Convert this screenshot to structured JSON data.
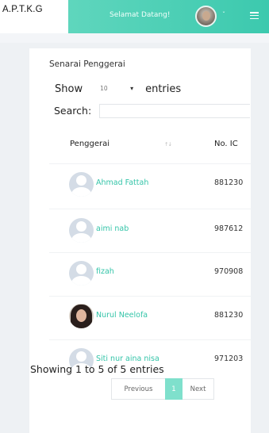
{
  "brand": {
    "text": "A.P.T.K.G"
  },
  "navbar": {
    "welcome": "Selamat Datang!",
    "caret": "ˇ",
    "menu_icon": "hamburger-icon"
  },
  "card": {
    "title": "Senarai Penggerai"
  },
  "length_control": {
    "show_label": "Show",
    "selected": "10",
    "entries_label": "entries"
  },
  "search": {
    "label": "Search:",
    "value": ""
  },
  "table": {
    "columns": {
      "name": "Penggerai",
      "sort_glyph": "↑↓",
      "ic": "No. IC"
    },
    "rows": [
      {
        "name": "Ahmad Fattah",
        "ic": "881230",
        "avatar": "default-avatar-icon"
      },
      {
        "name": "aimi nab",
        "ic": "987612",
        "avatar": "default-avatar-icon"
      },
      {
        "name": "fizah",
        "ic": "970908",
        "avatar": "default-avatar-icon"
      },
      {
        "name": "Nurul Neelofa",
        "ic": "881230",
        "avatar": "photo"
      },
      {
        "name": "Siti nur aina nisa",
        "ic": "971203",
        "avatar": "default-avatar-icon"
      }
    ]
  },
  "info": {
    "text": "Showing 1 to 5 of 5 entries"
  },
  "pagination": {
    "previous": "Previous",
    "current": "1",
    "next": "Next"
  },
  "colors": {
    "accent": "#3cc9ae",
    "link": "#33c4a8",
    "active_page": "#7fe0cc"
  }
}
